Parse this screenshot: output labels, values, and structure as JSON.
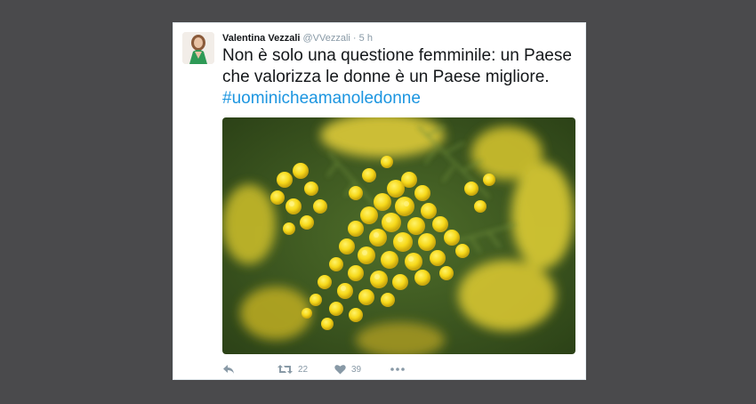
{
  "tweet": {
    "author_name": "Valentina Vezzali",
    "handle": "@VVezzali",
    "separator": "·",
    "time": "5 h",
    "text_main": "Non è solo una questione femminile: un Paese che valorizza le donne è un Paese migliore.",
    "hashtag": "#uominicheamanoledonne",
    "actions": {
      "retweet_count": "22",
      "like_count": "39"
    }
  },
  "colors": {
    "background": "#4a4a4c",
    "card": "#ffffff",
    "link": "#1b95e0",
    "muted": "#8899a6",
    "flower": "#ffe31a"
  },
  "icons": [
    "reply-icon",
    "retweet-icon",
    "heart-icon",
    "more-icon"
  ]
}
